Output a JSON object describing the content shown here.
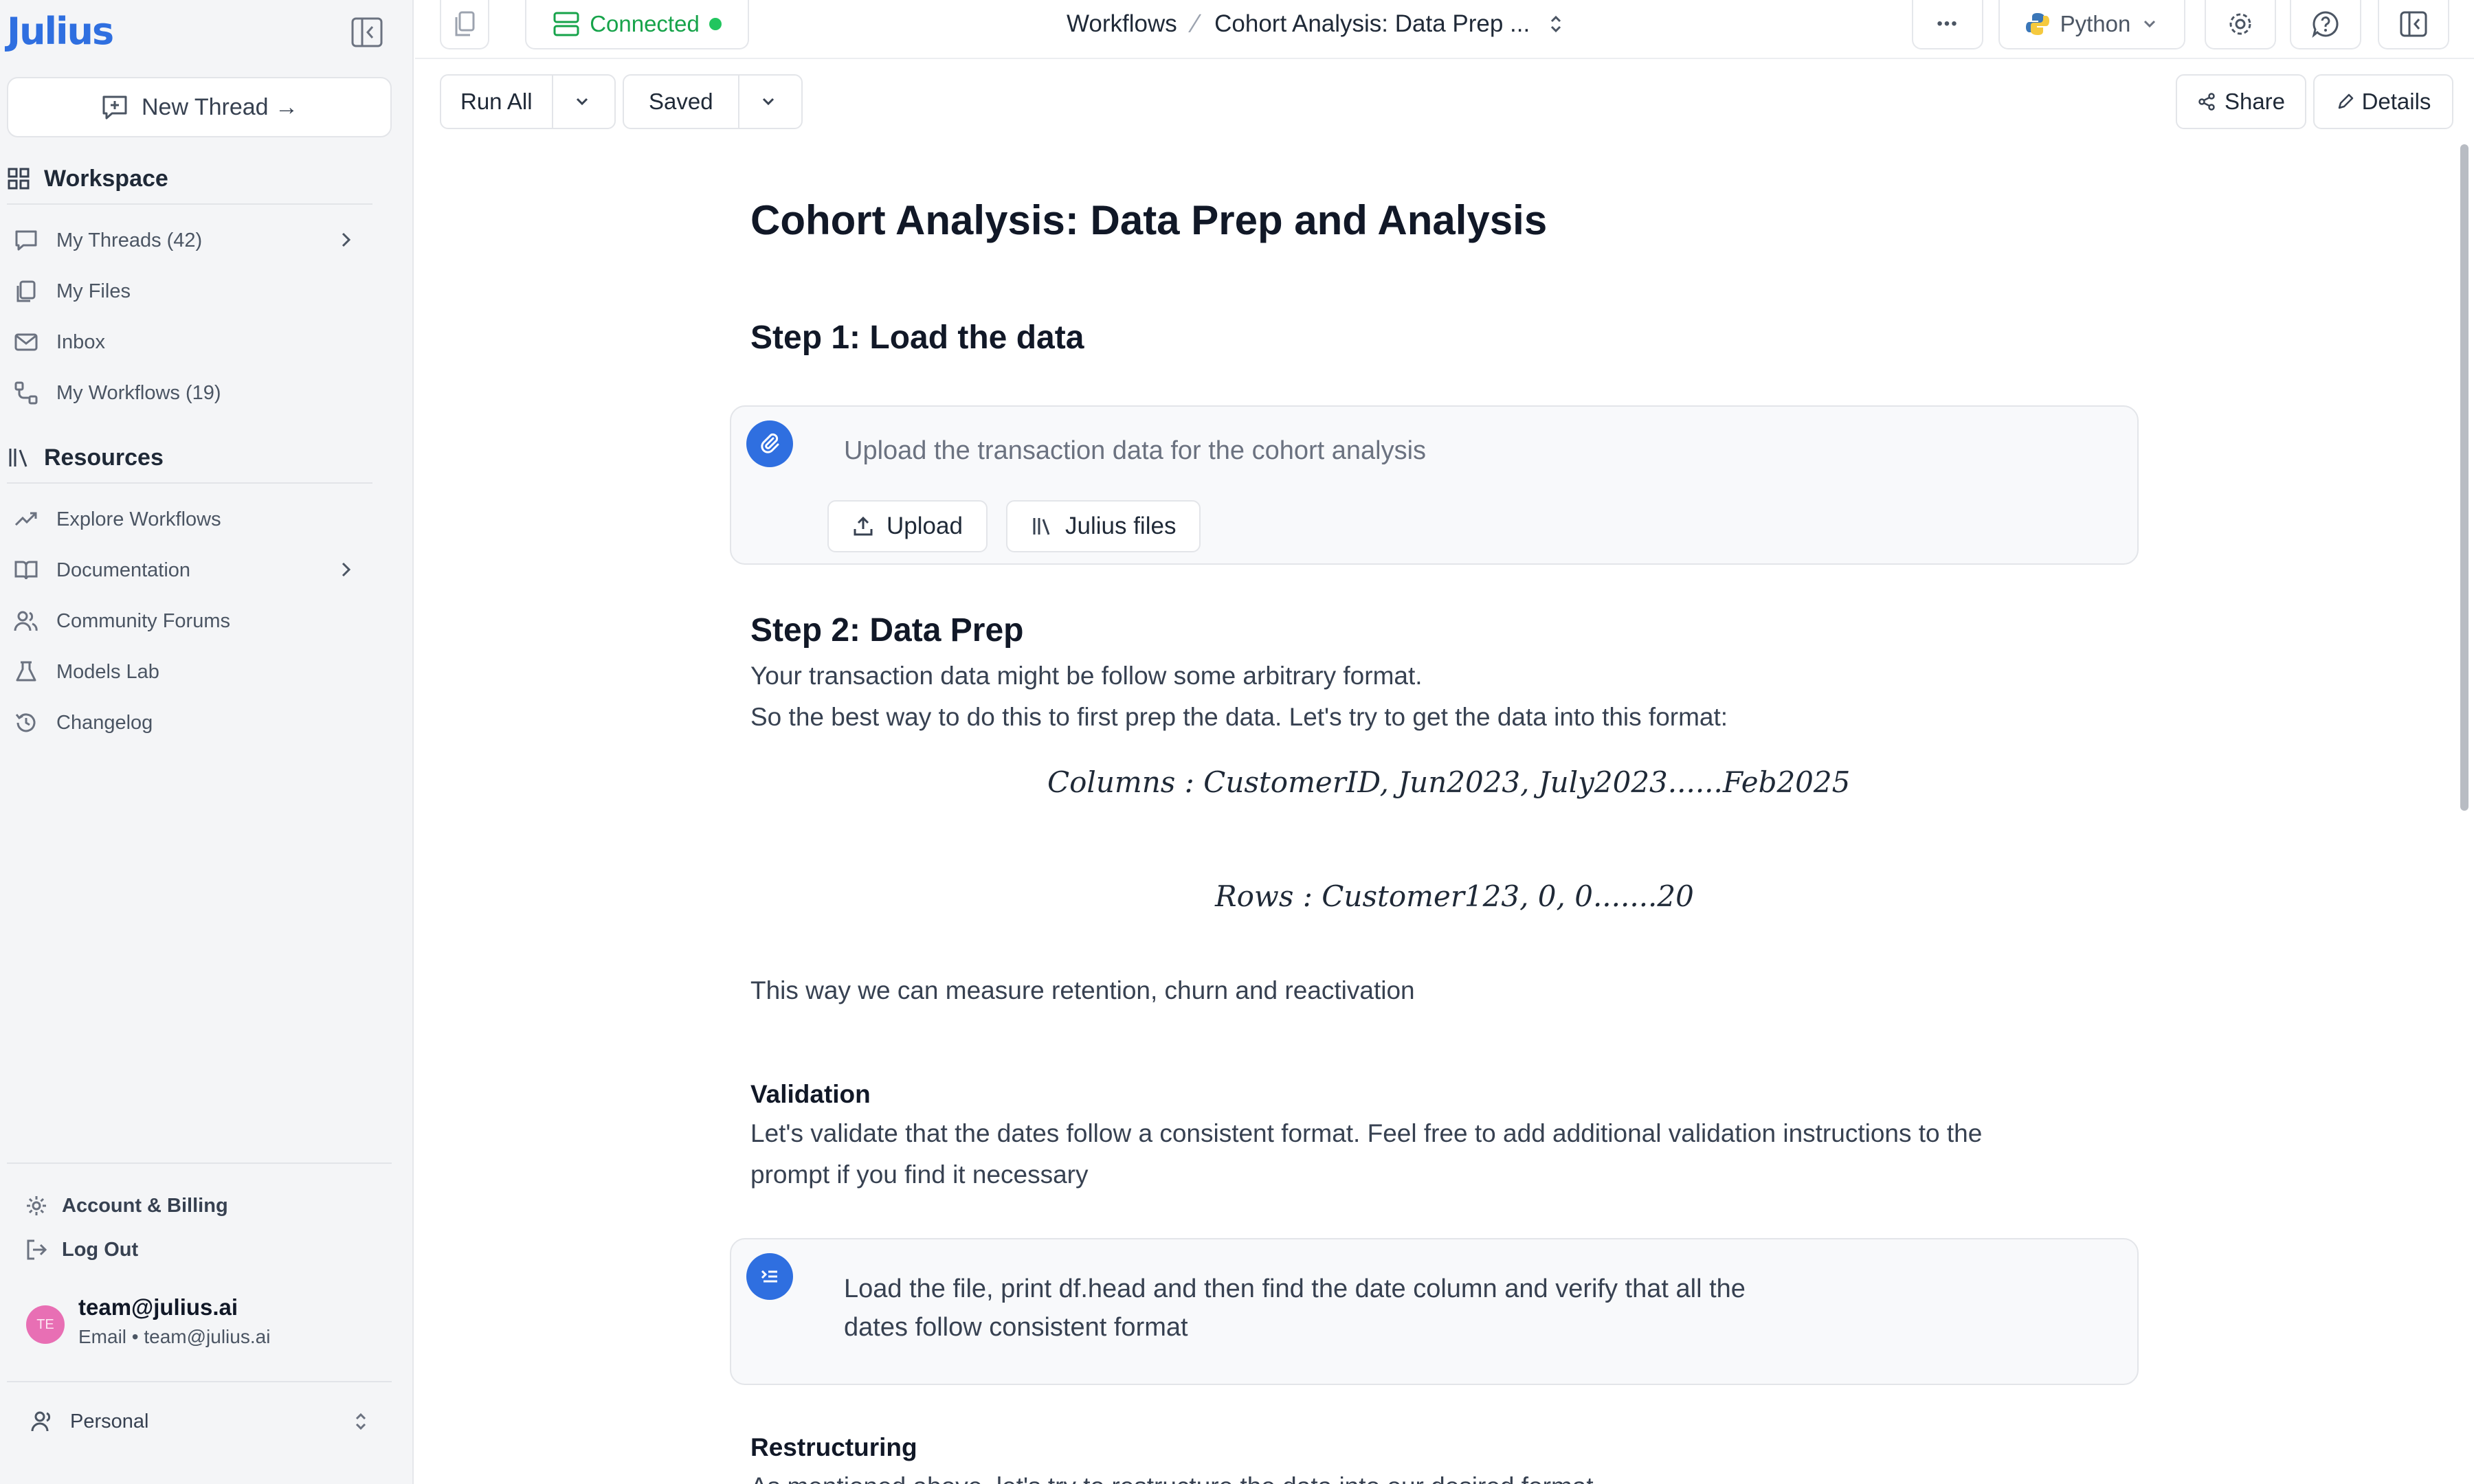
{
  "sidebar": {
    "logo": "Julius",
    "new_thread_label": "New Thread →",
    "workspace": {
      "heading": "Workspace",
      "items": [
        {
          "label": "My Threads (42)"
        },
        {
          "label": "My Files"
        },
        {
          "label": "Inbox"
        },
        {
          "label": "My Workflows (19)"
        }
      ]
    },
    "resources": {
      "heading": "Resources",
      "items": [
        {
          "label": "Explore Workflows"
        },
        {
          "label": "Documentation"
        },
        {
          "label": "Community Forums"
        },
        {
          "label": "Models Lab"
        },
        {
          "label": "Changelog"
        }
      ]
    },
    "account": {
      "billing_label": "Account & Billing",
      "logout_label": "Log Out",
      "avatar_initials": "TE",
      "user_name": "team@julius.ai",
      "user_email": "Email • team@julius.ai"
    },
    "personal_label": "Personal"
  },
  "topbar": {
    "connection_status": "Connected",
    "breadcrumb_root": "Workflows",
    "breadcrumb_separator": "⁄",
    "breadcrumb_current": "Cohort Analysis: Data Prep ...",
    "more_icon": "•••",
    "language": "Python"
  },
  "toolbar": {
    "run_all_label": "Run All",
    "saved_label": "Saved",
    "share_label": "Share",
    "details_label": "Details"
  },
  "document": {
    "title": "Cohort Analysis: Data Prep and Analysis",
    "step1": {
      "heading": "Step 1: Load the data",
      "prompt": "Upload the transaction data for the cohort analysis",
      "upload_label": "Upload",
      "julius_files_label": "Julius files"
    },
    "step2": {
      "heading": "Step 2: Data Prep",
      "line1": "Your transaction data might be follow some arbitrary format.",
      "line2": "So the best way to do this to first prep the data. Let's try to get the data into this format:",
      "math_columns": "Columns : CustomerID, Jun2023, July2023......Feb2025",
      "math_rows": "Rows : Customer123, 0, 0.......20",
      "measure_line": "This way we can measure retention, churn and reactivation"
    },
    "validation": {
      "heading": "Validation",
      "line1": "Let's validate that the dates follow a consistent format. Feel free to add additional validation instructions to the",
      "line2": "prompt if you find it necessary",
      "prompt_line1": "Load the file, print df.head and then find the date column and verify that all the",
      "prompt_line2": "dates follow consistent format"
    },
    "restructuring": {
      "heading": "Restructuring",
      "line1": "As mentioned above, let's try to restructure the data into our desired format"
    }
  },
  "colors": {
    "brand": "#2f6fe0",
    "connected": "#16a34a",
    "avatar": "#e86fb4"
  }
}
